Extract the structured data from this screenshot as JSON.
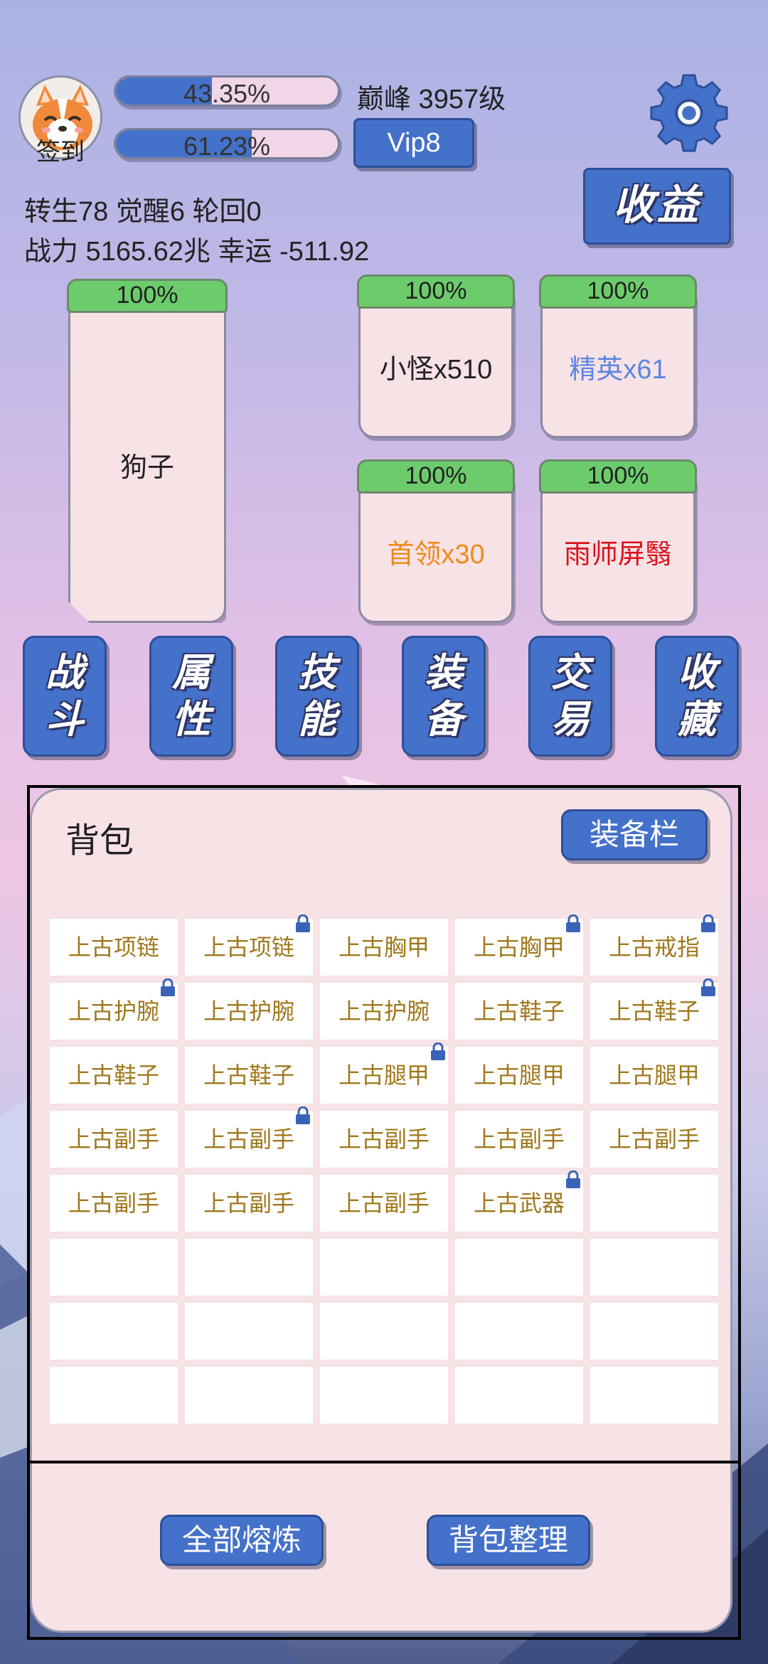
{
  "header": {
    "avatar_label": "签到",
    "bar1_text": "43.35%",
    "bar1_fill": 0.4335,
    "bar2_text": "61.23%",
    "bar2_fill": 0.6123,
    "level_text": "巅峰 3957级",
    "vip_label": "Vip8",
    "earnings_label": "收益",
    "stats_line1": "转生78 觉醒6 轮回0",
    "stats_line2": "战力 5165.62兆  幸运 -511.92"
  },
  "cards": [
    {
      "tab": "100%",
      "name": "狗子",
      "color": "#222222"
    },
    {
      "tab": "100%",
      "name": "小怪x510",
      "color": "#222222"
    },
    {
      "tab": "100%",
      "name": "精英x61",
      "color": "#5c86e0"
    },
    {
      "tab": "100%",
      "name": "首领x30",
      "color": "#ef8a1a"
    },
    {
      "tab": "100%",
      "name": "雨师屏翳",
      "color": "#d9121a"
    }
  ],
  "nav": [
    {
      "line1": "战",
      "line2": "斗"
    },
    {
      "line1": "属",
      "line2": "性"
    },
    {
      "line1": "技",
      "line2": "能"
    },
    {
      "line1": "装",
      "line2": "备"
    },
    {
      "line1": "交",
      "line2": "易"
    },
    {
      "line1": "收",
      "line2": "藏"
    }
  ],
  "bag": {
    "title": "背包",
    "equip_label": "装备栏",
    "items": [
      {
        "name": "上古项链",
        "locked": false
      },
      {
        "name": "上古项链",
        "locked": true
      },
      {
        "name": "上古胸甲",
        "locked": false
      },
      {
        "name": "上古胸甲",
        "locked": true
      },
      {
        "name": "上古戒指",
        "locked": true
      },
      {
        "name": "上古护腕",
        "locked": true
      },
      {
        "name": "上古护腕",
        "locked": false
      },
      {
        "name": "上古护腕",
        "locked": false
      },
      {
        "name": "上古鞋子",
        "locked": false
      },
      {
        "name": "上古鞋子",
        "locked": true
      },
      {
        "name": "上古鞋子",
        "locked": false
      },
      {
        "name": "上古鞋子",
        "locked": false
      },
      {
        "name": "上古腿甲",
        "locked": true
      },
      {
        "name": "上古腿甲",
        "locked": false
      },
      {
        "name": "上古腿甲",
        "locked": false
      },
      {
        "name": "上古副手",
        "locked": false
      },
      {
        "name": "上古副手",
        "locked": true
      },
      {
        "name": "上古副手",
        "locked": false
      },
      {
        "name": "上古副手",
        "locked": false
      },
      {
        "name": "上古副手",
        "locked": false
      },
      {
        "name": "上古副手",
        "locked": false
      },
      {
        "name": "上古副手",
        "locked": false
      },
      {
        "name": "上古副手",
        "locked": false
      },
      {
        "name": "上古武器",
        "locked": true
      },
      {
        "name": "",
        "locked": false
      },
      {
        "name": "",
        "locked": false
      },
      {
        "name": "",
        "locked": false
      },
      {
        "name": "",
        "locked": false
      },
      {
        "name": "",
        "locked": false
      },
      {
        "name": "",
        "locked": false
      },
      {
        "name": "",
        "locked": false
      },
      {
        "name": "",
        "locked": false
      },
      {
        "name": "",
        "locked": false
      },
      {
        "name": "",
        "locked": false
      },
      {
        "name": "",
        "locked": false
      },
      {
        "name": "",
        "locked": false
      },
      {
        "name": "",
        "locked": false
      },
      {
        "name": "",
        "locked": false
      },
      {
        "name": "",
        "locked": false
      },
      {
        "name": "",
        "locked": false
      }
    ],
    "smelt_all_label": "全部熔炼",
    "sort_label": "背包整理"
  },
  "colors": {
    "accent_blue": "#4471c9",
    "tab_green": "#6ccc6c",
    "item_text": "#a0781c",
    "card_bg": "#f7e2e6"
  }
}
